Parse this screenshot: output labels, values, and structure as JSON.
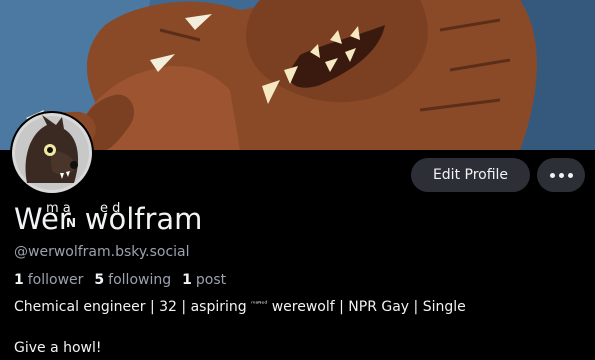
{
  "profile": {
    "display_name_part1": "Wer",
    "display_name_part2": "wolfram",
    "display_name_mark_n": "N",
    "display_name_mark_m": "m a",
    "display_name_mark_ed": "e d",
    "handle": "@werwolfram.bsky.social",
    "stats": {
      "followers_count": "1",
      "followers_label": "follower",
      "following_count": "5",
      "following_label": "following",
      "posts_count": "1",
      "posts_label": "post"
    },
    "bio_before": "Chemical engineer | 32 | aspiring ",
    "bio_tiny": "ᵐᵃᴺᵉᵈ",
    "bio_after": " werewolf | NPR Gay | Single",
    "bio_line2": "Give a howl!"
  },
  "actions": {
    "edit_profile_label": "Edit Profile",
    "more_icon": "ellipsis-icon"
  },
  "banner": {
    "description_icon": "werewolf-banner-art"
  },
  "colors": {
    "background": "#000000",
    "button_bg": "#2c2f35",
    "text_primary": "#f1f3f5",
    "text_secondary": "#9aa2ad",
    "banner_sky": "#3f6a93",
    "fur": "#8a4a28"
  }
}
